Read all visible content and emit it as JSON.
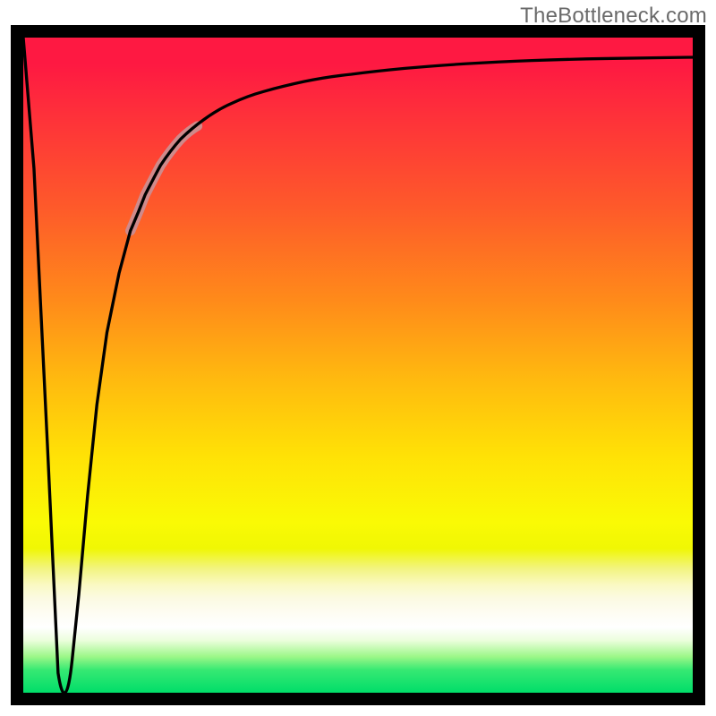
{
  "attribution": "TheBottleneck.com",
  "colors": {
    "frame": "#000000",
    "curve": "#000000",
    "highlight": "#cf8a8b",
    "attribution": "#6a6a6a",
    "gradient_top": "#fe1942",
    "gradient_mid": "#ffe206",
    "gradient_bottom": "#00dd69"
  },
  "chart_data": {
    "type": "line",
    "title": "",
    "xlabel": "",
    "ylabel": "",
    "legend": false,
    "series": [
      {
        "name": "curve",
        "x": [
          0.0,
          0.016,
          0.036,
          0.052,
          0.062,
          0.073,
          0.083,
          0.096,
          0.11,
          0.125,
          0.143,
          0.16,
          0.182,
          0.205,
          0.235,
          0.27,
          0.312,
          0.36,
          0.42,
          0.49,
          0.57,
          0.66,
          0.76,
          0.87,
          1.0
        ],
        "y": [
          1.0,
          0.8,
          0.38,
          0.03,
          0.0,
          0.05,
          0.15,
          0.3,
          0.44,
          0.55,
          0.64,
          0.705,
          0.76,
          0.805,
          0.845,
          0.875,
          0.9,
          0.918,
          0.933,
          0.944,
          0.953,
          0.96,
          0.965,
          0.968,
          0.97
        ]
      },
      {
        "name": "highlight-segment",
        "x": [
          0.16,
          0.182,
          0.205,
          0.235,
          0.26
        ],
        "y": [
          0.705,
          0.76,
          0.805,
          0.845,
          0.865
        ]
      }
    ],
    "xlim": [
      0,
      1
    ],
    "ylim": [
      0,
      1
    ],
    "highlight": {
      "on_series": "curve",
      "x_range": [
        0.16,
        0.26
      ],
      "stroke_width_px": 12,
      "color": "#cf8a8b"
    },
    "background": "vertical-gradient",
    "frame_stroke_px": 14
  }
}
